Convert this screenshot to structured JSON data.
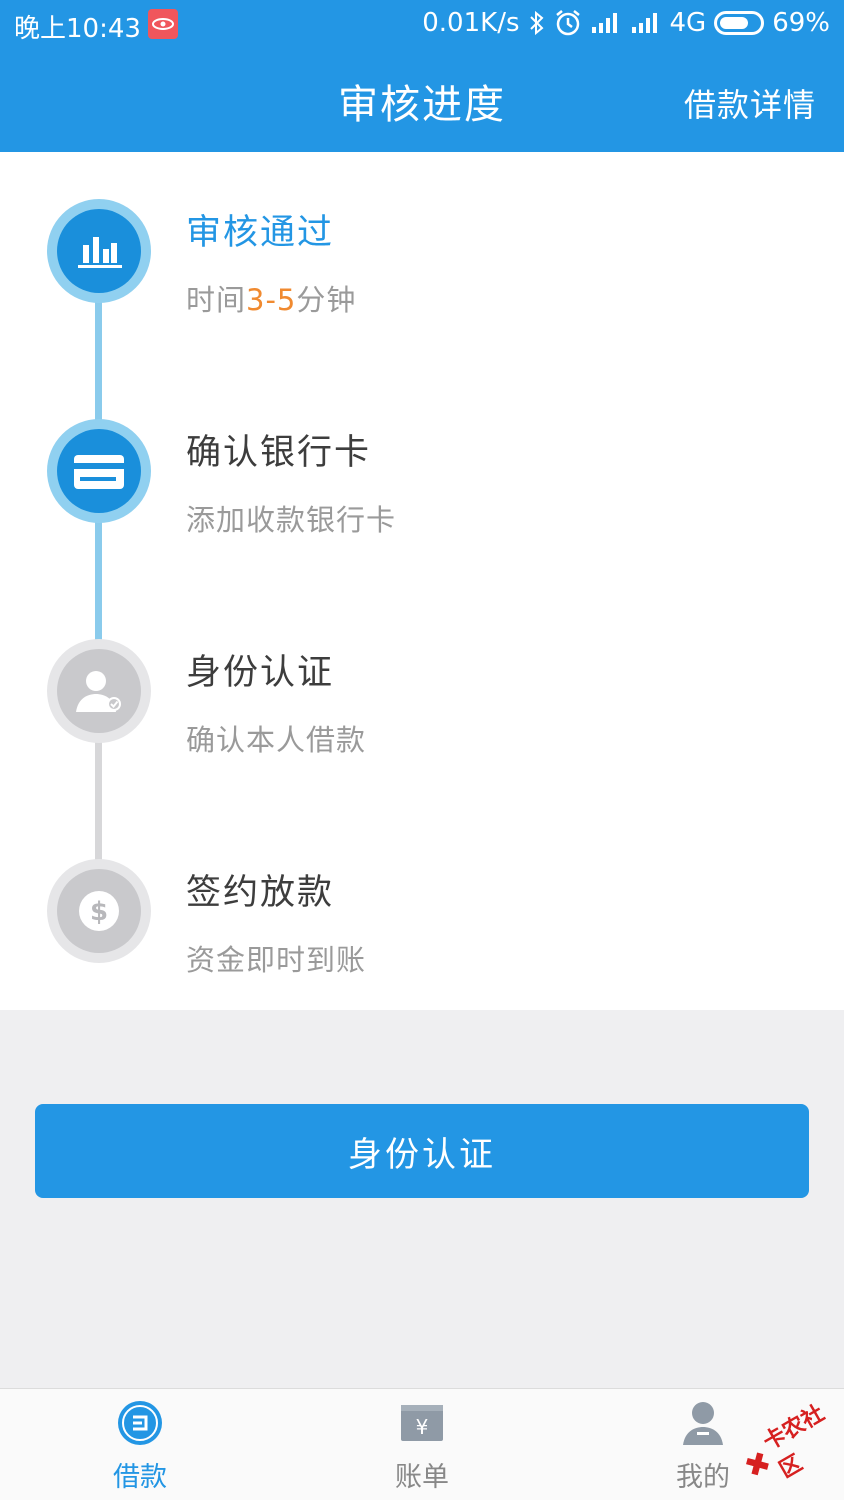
{
  "status_bar": {
    "time": "晚上10:43",
    "speed": "0.01K/s",
    "network": "4G",
    "battery": "69%"
  },
  "header": {
    "title": "审核进度",
    "detail_link": "借款详情"
  },
  "steps": [
    {
      "title": "审核通过",
      "sub_prefix": "时间",
      "sub_highlight": "3-5",
      "sub_suffix": "分钟",
      "state": "done",
      "icon": "bar-chart-icon"
    },
    {
      "title": "确认银行卡",
      "sub": "添加收款银行卡",
      "state": "active",
      "icon": "bank-card-icon"
    },
    {
      "title": "身份认证",
      "sub": "确认本人借款",
      "state": "pending",
      "icon": "user-verify-icon"
    },
    {
      "title": "签约放款",
      "sub": "资金即时到账",
      "state": "pending",
      "icon": "dollar-coin-icon"
    }
  ],
  "main_button": {
    "label": "身份认证"
  },
  "tabbar": {
    "items": [
      {
        "label": "借款",
        "icon": "loan-icon",
        "active": true
      },
      {
        "label": "账单",
        "icon": "bill-icon",
        "active": false
      },
      {
        "label": "我的",
        "icon": "profile-icon",
        "active": false
      }
    ]
  },
  "watermark": {
    "text": "卡农社区"
  },
  "colors": {
    "primary": "#2396e4",
    "highlight": "#f08a30",
    "active_ring": "#90d0f0",
    "inactive": "#c9c9cc"
  }
}
